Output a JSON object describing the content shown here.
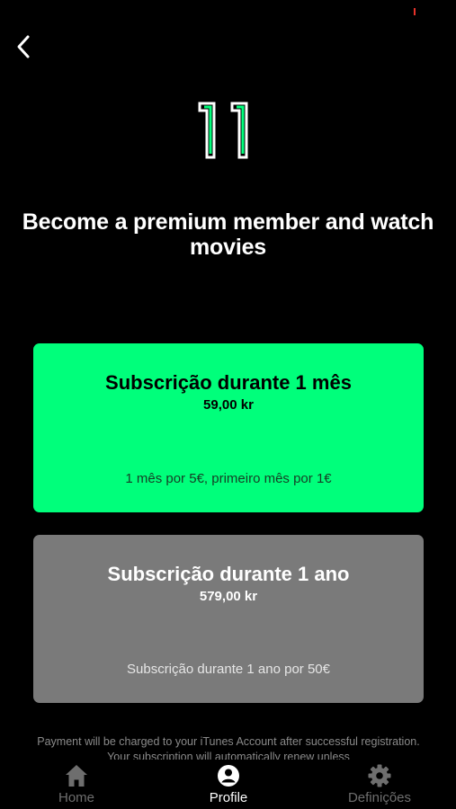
{
  "colors": {
    "background": "#000000",
    "accent_green": "#00ff7b",
    "card_grey": "#7a7a7a",
    "tab_inactive": "#6e6e6e",
    "tab_active": "#ffffff"
  },
  "header": {
    "back_icon": "chevron-left-icon",
    "logo_text": "11"
  },
  "headline": "Become a premium member and watch movies",
  "plans": [
    {
      "title": "Subscrição durante 1 mês",
      "price": "59,00 kr",
      "description": "1 mês por 5€, primeiro mês por 1€"
    },
    {
      "title": "Subscrição durante 1 ano",
      "price": "579,00 kr",
      "description": "Subscrição durante 1 ano por 50€"
    }
  ],
  "legal": "Payment will be charged to your iTunes Account after successful registration. Your subscription will automatically renew unless",
  "tabs": [
    {
      "label": "Home",
      "icon": "home-icon",
      "active": false
    },
    {
      "label": "Profile",
      "icon": "user-icon",
      "active": true
    },
    {
      "label": "Definições",
      "icon": "gear-icon",
      "active": false
    }
  ]
}
